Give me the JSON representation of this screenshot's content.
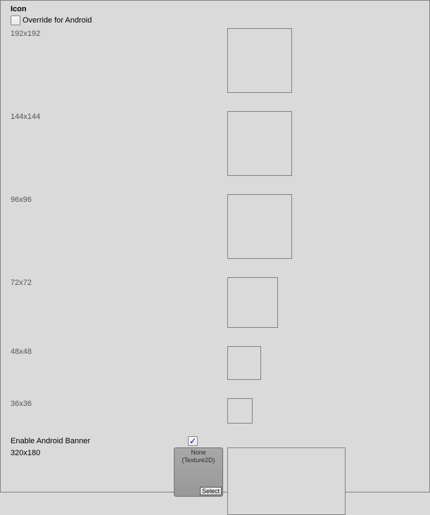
{
  "section": {
    "title": "Icon"
  },
  "override": {
    "label": "Override for Android",
    "checked": false
  },
  "icons": [
    {
      "label": "192x192"
    },
    {
      "label": "144x144"
    },
    {
      "label": "96x96"
    },
    {
      "label": "72x72"
    },
    {
      "label": "48x48"
    },
    {
      "label": "36x36"
    }
  ],
  "banner": {
    "enable_label": "Enable Android Banner",
    "enabled": true,
    "size_label": "320x180",
    "slot_text_line1": "None",
    "slot_text_line2": "(Texture2D)",
    "select_label": "Select"
  }
}
